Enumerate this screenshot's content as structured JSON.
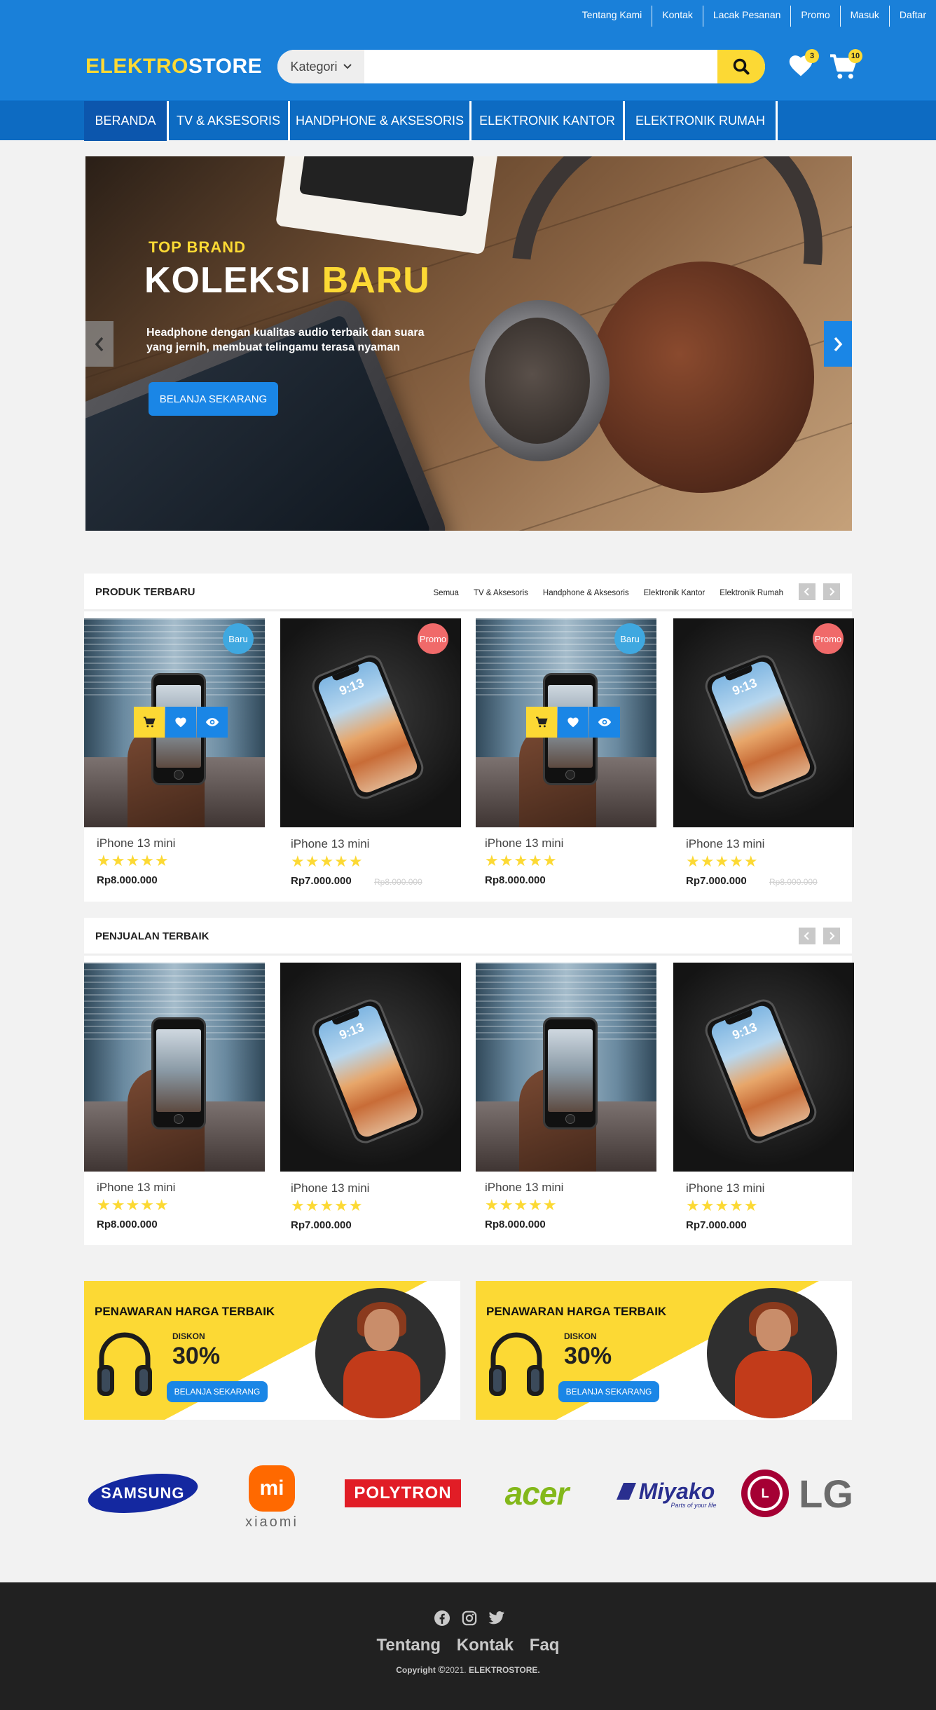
{
  "header": {
    "top_links": [
      "Tentang Kami",
      "Kontak",
      "Lacak Pesanan",
      "Promo",
      "Masuk",
      "Daftar"
    ],
    "logo_part1": "ELEKTRO",
    "logo_part2": "STORE",
    "search": {
      "category_label": "Kategori",
      "placeholder": "",
      "icon": "search-icon"
    },
    "wishlist_count": "3",
    "cart_count": "10"
  },
  "nav": {
    "items": [
      "BERANDA",
      "TV & AKSESORIS",
      "HANDPHONE & AKSESORIS",
      "ELEKTRONIK KANTOR",
      "ELEKTRONIK RUMAH"
    ],
    "active": "BERANDA"
  },
  "hero": {
    "kicker": "TOP BRAND",
    "title_white": "KOLEKSI",
    "title_yellow": "BARU",
    "description": "Headphone dengan kualitas audio terbaik dan suara yang jernih, membuat telingamu terasa nyaman",
    "button": "BELANJA SEKARANG"
  },
  "latest": {
    "title": "PRODUK TERBARU",
    "filters": [
      "Semua",
      "TV & Aksesoris",
      "Handphone & Aksesoris",
      "Elektronik Kantor",
      "Elektronik Rumah"
    ],
    "products": [
      {
        "name": "iPhone 13 mini",
        "price": "Rp8.000.000",
        "old_price": "",
        "badge": "Baru",
        "rating": 5
      },
      {
        "name": "iPhone 13 mini",
        "price": "Rp7.000.000",
        "old_price": "Rp8.000.000",
        "badge": "Promo",
        "rating": 5
      },
      {
        "name": "iPhone 13 mini",
        "price": "Rp8.000.000",
        "old_price": "",
        "badge": "Baru",
        "rating": 5
      },
      {
        "name": "iPhone 13 mini",
        "price": "Rp7.000.000",
        "old_price": "Rp8.000.000",
        "badge": "Promo",
        "rating": 5
      }
    ]
  },
  "best": {
    "title": "PENJUALAN TERBAIK",
    "products": [
      {
        "name": "iPhone 13 mini",
        "price": "Rp8.000.000",
        "rating": 5
      },
      {
        "name": "iPhone 13 mini",
        "price": "Rp7.000.000",
        "rating": 5
      },
      {
        "name": "iPhone 13 mini",
        "price": "Rp8.000.000",
        "rating": 5
      },
      {
        "name": "iPhone 13 mini",
        "price": "Rp7.000.000",
        "rating": 5
      }
    ]
  },
  "promos": [
    {
      "title": "PENAWARAN HARGA TERBAIK",
      "discount_label": "DISKON",
      "discount": "30%",
      "button": "BELANJA SEKARANG"
    },
    {
      "title": "PENAWARAN HARGA TERBAIK",
      "discount_label": "DISKON",
      "discount": "30%",
      "button": "BELANJA SEKARANG"
    }
  ],
  "brands": [
    "SAMSUNG",
    "xiaomi",
    "POLYTRON",
    "acer",
    "Miyako",
    "LG"
  ],
  "brand_extra": {
    "miyako_tagline": "Parts of your life",
    "xiaomi_mark": "mi"
  },
  "footer": {
    "links": [
      "Tentang",
      "Kontak",
      "Faq"
    ],
    "copyright_prefix": "Copyright",
    "year": "2021.",
    "brand": "ELEKTROSTORE."
  },
  "colors": {
    "primary": "#1a80d9",
    "nav": "#0d6bc2",
    "accent": "#fcd934",
    "button": "#1a86e6",
    "badge_new": "#3fa8e0",
    "badge_promo": "#f06a6a",
    "footer": "#212121"
  }
}
